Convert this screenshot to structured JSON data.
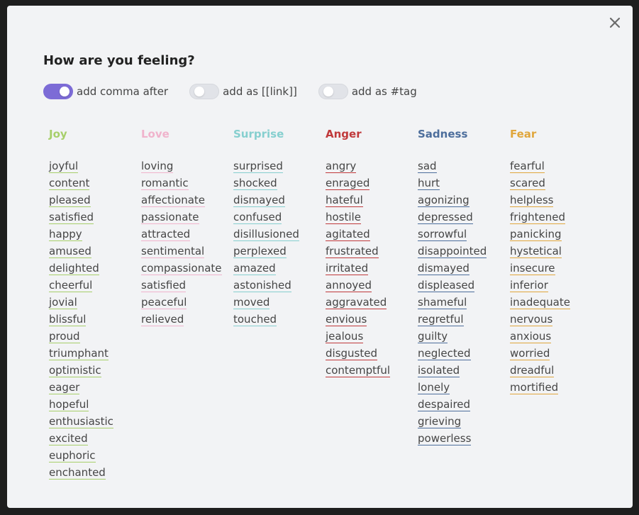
{
  "dialog": {
    "close_label": "×",
    "close_icon": "close-icon",
    "title": "How are you feeling?"
  },
  "toggles": [
    {
      "label": "add comma after",
      "on": true,
      "accent": "#7c6bd6"
    },
    {
      "label": "add as [[link]]",
      "on": false
    },
    {
      "label": "add as #tag",
      "on": false
    }
  ],
  "emotions": [
    {
      "name": "Joy",
      "color": "#a7cf6a",
      "words": [
        "joyful",
        "content",
        "pleased",
        "satisfied",
        "happy",
        "amused",
        "delighted",
        "cheerful",
        "jovial",
        "blissful",
        "proud",
        "triumphant",
        "optimistic",
        "eager",
        "hopeful",
        "enthusiastic",
        "excited",
        "euphoric",
        "enchanted"
      ]
    },
    {
      "name": "Love",
      "color": "#f0b3cc",
      "words": [
        "loving",
        "romantic",
        "affectionate",
        "passionate",
        "attracted",
        "sentimental",
        "compassionate",
        "satisfied",
        "peaceful",
        "relieved"
      ]
    },
    {
      "name": "Surprise",
      "color": "#86cfcf",
      "words": [
        "surprised",
        "shocked",
        "dismayed",
        "confused",
        "disillusioned",
        "perplexed",
        "amazed",
        "astonished",
        "moved",
        "touched"
      ]
    },
    {
      "name": "Anger",
      "color": "#c0393b",
      "words": [
        "angry",
        "enraged",
        "hateful",
        "hostile",
        "agitated",
        "frustrated",
        "irritated",
        "annoyed",
        "aggravated",
        "envious",
        "jealous",
        "disgusted",
        "contemptful"
      ]
    },
    {
      "name": "Sadness",
      "color": "#4d6e9c",
      "words": [
        "sad",
        "hurt",
        "agonizing",
        "depressed",
        "sorrowful",
        "disappointed",
        "dismayed",
        "displeased",
        "shameful",
        "regretful",
        "guilty",
        "neglected",
        "isolated",
        "lonely",
        "despaired",
        "grieving",
        "powerless"
      ]
    },
    {
      "name": "Fear",
      "color": "#e0a63c",
      "words": [
        "fearful",
        "scared",
        "helpless",
        "frightened",
        "panicking",
        "hystetical",
        "insecure",
        "inferior",
        "inadequate",
        "nervous",
        "anxious",
        "worried",
        "dreadful",
        "mortified"
      ]
    }
  ]
}
